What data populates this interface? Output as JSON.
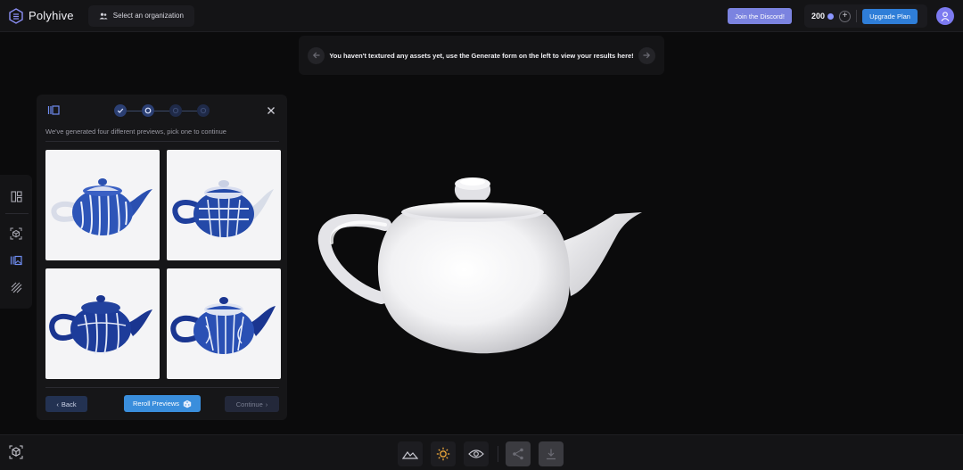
{
  "header": {
    "brand_name": "Polyhive",
    "org_button": "Select an organization",
    "discord_button": "Join the Discord!",
    "credits": "200",
    "upgrade_button": "Upgrade Plan"
  },
  "notice": {
    "text": "You haven't textured any assets yet, use the Generate form on the left to view your results here!"
  },
  "panel": {
    "subtitle": "We've generated four different previews, pick one to continue",
    "steps": [
      {
        "state": "done"
      },
      {
        "state": "current"
      },
      {
        "state": "pending"
      },
      {
        "state": "pending"
      }
    ],
    "previews": [
      {
        "name": "preview-1"
      },
      {
        "name": "preview-2"
      },
      {
        "name": "preview-3"
      },
      {
        "name": "preview-4"
      }
    ],
    "back_label": "Back",
    "reroll_label": "Reroll Previews",
    "continue_label": "Continue"
  },
  "colors": {
    "accent_blue": "#3a8edc",
    "discord": "#7b83e0",
    "avatar": "#7c7af0",
    "panel_bg": "#161618",
    "page_bg": "#0b0b0c"
  },
  "icons": {
    "brand": "polyhive-logo-icon",
    "org": "users-icon",
    "credits": "credit-coin-icon",
    "avatar": "user-icon",
    "prev": "arrow-left-icon",
    "next": "arrow-right-icon",
    "tools": [
      "layout-icon",
      "cube-scan-icon",
      "texture-icon",
      "hatch-icon"
    ],
    "bottom": [
      "landscape-icon",
      "sun-icon",
      "eye-icon",
      "share-icon",
      "download-icon"
    ]
  }
}
